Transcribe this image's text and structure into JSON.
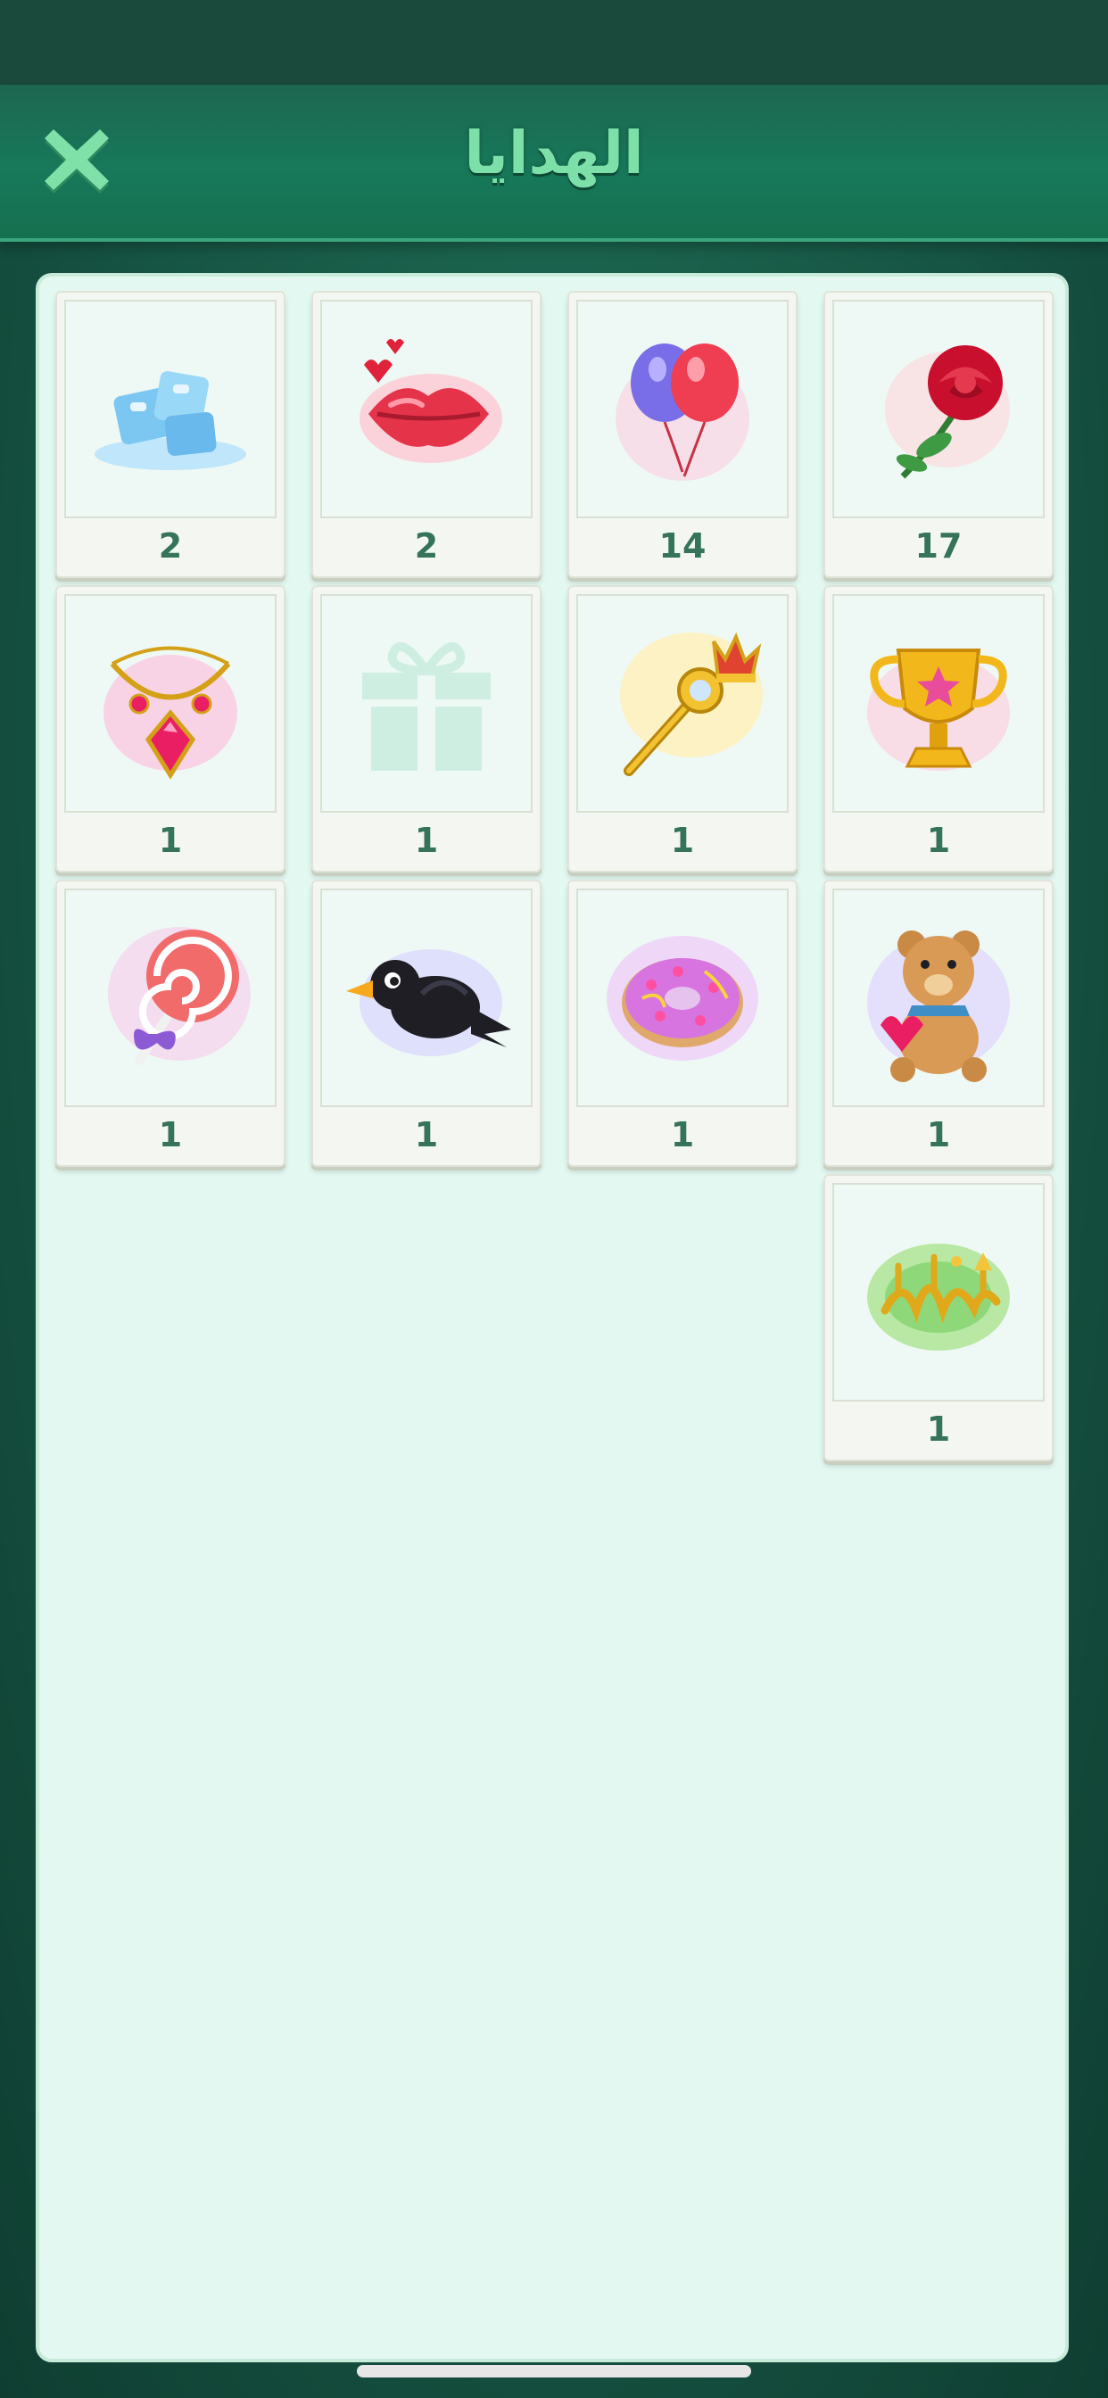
{
  "header": {
    "title": "الهدايا",
    "close_icon": "close-x-icon"
  },
  "colors": {
    "background": "#165443",
    "header": "#17795a",
    "title": "#7ee0a9",
    "panel": "#e2f8f1",
    "count_text": "#35735a"
  },
  "gifts": [
    {
      "icon": "ice-cubes-icon",
      "count": "2"
    },
    {
      "icon": "lips-kiss-icon",
      "count": "2"
    },
    {
      "icon": "balloons-icon",
      "count": "14"
    },
    {
      "icon": "red-rose-icon",
      "count": "17"
    },
    {
      "icon": "necklace-icon",
      "count": "1"
    },
    {
      "icon": "gift-box-icon",
      "count": "1"
    },
    {
      "icon": "royal-scepter-icon",
      "count": "1"
    },
    {
      "icon": "trophy-icon",
      "count": "1"
    },
    {
      "icon": "lollipop-icon",
      "count": "1"
    },
    {
      "icon": "crow-bird-icon",
      "count": "1"
    },
    {
      "icon": "donut-icon",
      "count": "1"
    },
    {
      "icon": "teddy-bear-icon",
      "count": "1"
    },
    {
      "icon": "ramadan-calligraphy-icon",
      "count": "1"
    }
  ]
}
